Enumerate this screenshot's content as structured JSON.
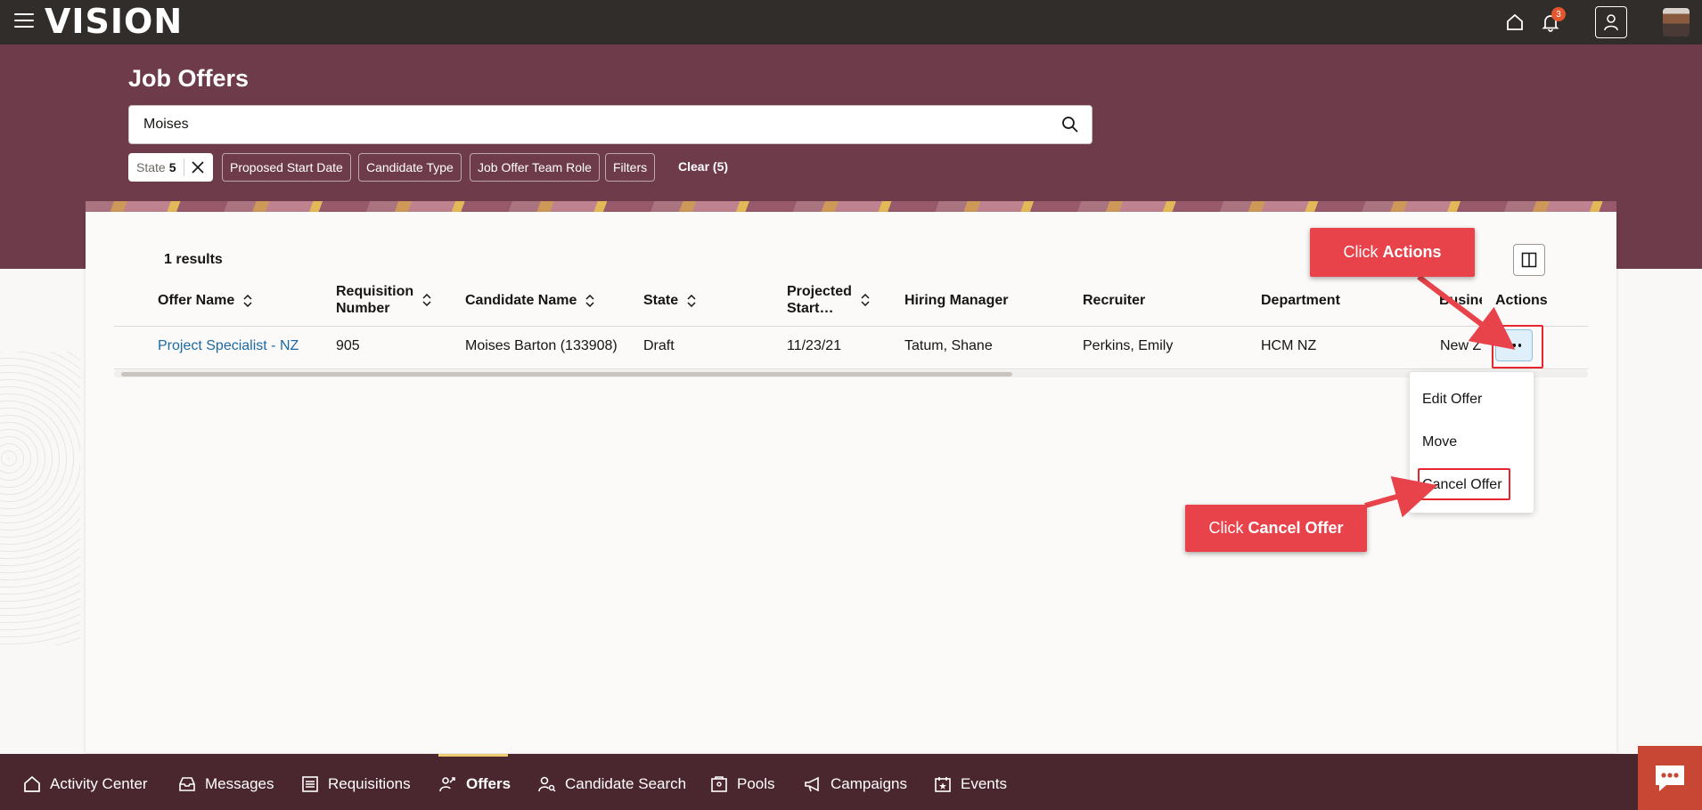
{
  "app": {
    "logo": "VISION",
    "notification_count": "3"
  },
  "header": {
    "title": "Job Offers",
    "search_value": "Moises",
    "filters": {
      "state_label": "State",
      "state_count": "5",
      "chips": [
        "Proposed Start Date",
        "Candidate Type",
        "Job Offer Team Role",
        "Filters"
      ],
      "clear": "Clear (5)"
    }
  },
  "results": {
    "count_label": "1 results",
    "columns": [
      "Offer Name",
      "Requisition Number",
      "Candidate Name",
      "State",
      "Projected Start…",
      "Hiring Manager",
      "Recruiter",
      "Department",
      "Business Unit",
      "Actions"
    ],
    "column_lines": {
      "req_1": "Requisition",
      "req_2": "Number",
      "proj_1": "Projected",
      "proj_2": "Start…",
      "business_partial": "Busine"
    },
    "rows": [
      {
        "offer_name": "Project Specialist - NZ",
        "requisition_number": "905",
        "candidate_name": "Moises Barton (133908)",
        "state": "Draft",
        "projected_start": "11/23/21",
        "hiring_manager": "Tatum, Shane",
        "recruiter": "Perkins, Emily",
        "department": "HCM NZ",
        "business_unit_partial": "New Z"
      }
    ]
  },
  "actions_menu": {
    "items": [
      "Edit Offer",
      "Move",
      "Cancel Offer"
    ]
  },
  "callouts": {
    "actions_prefix": "Click",
    "actions_bold": "Actions",
    "cancel_prefix": "Click",
    "cancel_bold": "Cancel Offer"
  },
  "bottom_nav": {
    "items": [
      "Activity Center",
      "Messages",
      "Requisitions",
      "Offers",
      "Candidate Search",
      "Pools",
      "Campaigns",
      "Events"
    ],
    "active": "Offers"
  },
  "colors": {
    "band": "#6e3b4b",
    "topbar": "#312d2a",
    "bottombar": "#4a262f",
    "callout": "#e8424a",
    "link": "#1b6aa5"
  }
}
